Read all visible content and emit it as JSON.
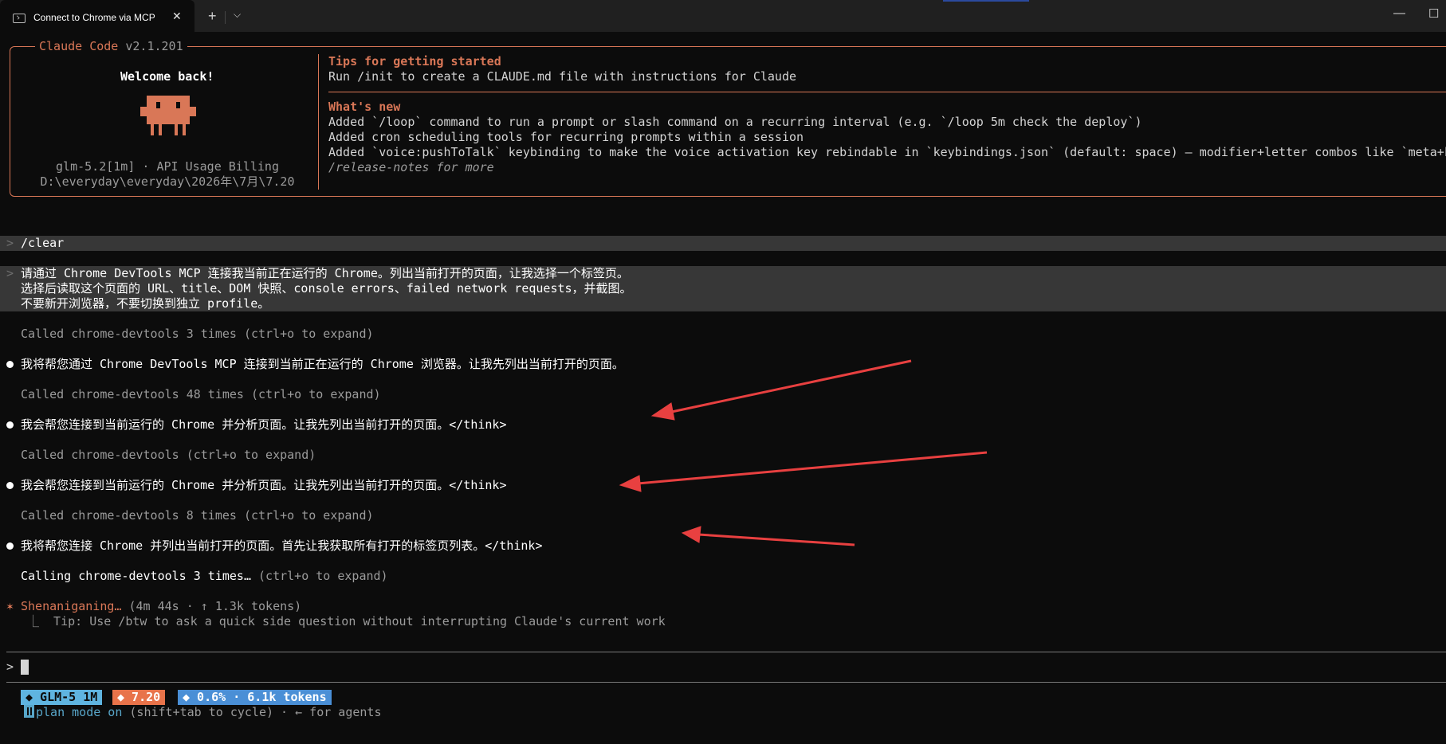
{
  "window": {
    "tab_title": "Connect to Chrome via MCP",
    "tab_close": "✕",
    "new_tab": "+",
    "dropdown": "⌵",
    "minimize": "—",
    "maximize": "☐"
  },
  "header": {
    "app_name": "Claude Code",
    "version": "v2.1.201",
    "welcome": "Welcome back!",
    "model_info": "glm-5.2[1m] · API Usage Billing",
    "path": "D:\\everyday\\everyday\\2026年\\7月\\7.20",
    "tips_title": "Tips for getting started",
    "tips_text": "Run /init to create a CLAUDE.md file with instructions for Claude",
    "whats_new_title": "What's new",
    "whats_new_items": [
      "Added `/loop` command to run a prompt or slash command on a recurring interval (e.g. `/loop 5m check the deploy`)",
      "Added cron scheduling tools for recurring prompts within a session",
      "Added `voice:pushToTalk` keybinding to make the voice activation key rebindable in `keybindings.json` (default: space) — modifier+letter combos like `meta+k"
    ],
    "release_notes": "/release-notes for more"
  },
  "transcript": {
    "prompt_marker": ">",
    "clear_cmd": "/clear",
    "user_message": [
      "请通过 Chrome DevTools MCP 连接我当前正在运行的 Chrome。列出当前打开的页面，让我选择一个标签页。",
      "选择后读取这个页面的 URL、title、DOM 快照、console errors、failed network requests，并截图。",
      "不要新开浏览器，不要切换到独立 profile。"
    ],
    "tool_call_1": "Called chrome-devtools 3 times (ctrl+o to expand)",
    "assistant_1": "我将帮您通过 Chrome DevTools MCP 连接到当前正在运行的 Chrome 浏览器。让我先列出当前打开的页面。",
    "tool_call_2": "Called chrome-devtools 48 times (ctrl+o to expand)",
    "assistant_2": "我会帮您连接到当前运行的 Chrome 并分析页面。让我先列出当前打开的页面。</think>",
    "tool_call_3": "Called chrome-devtools (ctrl+o to expand)",
    "assistant_3": "我会帮您连接到当前运行的 Chrome 并分析页面。让我先列出当前打开的页面。</think>",
    "tool_call_4": "Called chrome-devtools 8 times (ctrl+o to expand)",
    "assistant_4": "我将帮您连接 Chrome 并列出当前打开的页面。首先让我获取所有打开的标签页列表。</think>",
    "calling_main": "Calling chrome-devtools 3 times…",
    "calling_hint": " (ctrl+o to expand)"
  },
  "status": {
    "spinner": "✶",
    "spinner_text": "Shenaniganing…",
    "spinner_meta": " (4m 44s · ↑ 1.3k tokens)",
    "tip": "⎿  Tip: Use /btw to ask a quick side question without interrupting Claude's current work"
  },
  "input": {
    "prompt": ">"
  },
  "statusline": {
    "model_badge": "◆ GLM-5 1M",
    "dir_badge": "◆ 7.20",
    "context_badge": "◆ 0.6% · 6.1k tokens",
    "plan_mode": "plan mode on",
    "plan_hint": " (shift+tab to cycle) · ← for agents"
  },
  "colors": {
    "brand": "#d97757",
    "model_badge_bg": "#5fb4e0",
    "dir_badge_bg": "#e8734a",
    "context_badge_bg": "#4a8fd6",
    "plan_mode": "#58a6c9",
    "annotation_arrow": "#e84040"
  }
}
